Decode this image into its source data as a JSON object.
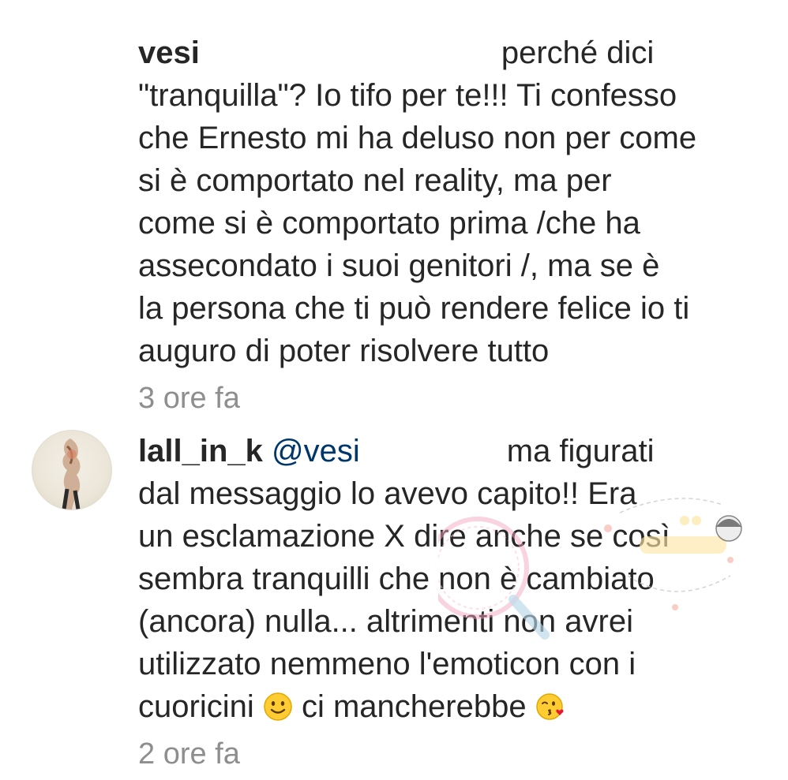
{
  "comments": [
    {
      "username": "vesi",
      "mention": "",
      "lines": [
        "perché dici",
        "\"tranquilla\"? Io tifo per te!!! Ti confesso",
        "che Ernesto mi ha deluso non per come",
        "si è comportato nel reality, ma per",
        "come si è comportato prima /che ha",
        "assecondato i suoi genitori /, ma se è",
        "la persona che ti può rendere felice io ti",
        "auguro di poter risolvere tutto"
      ],
      "time": "3 ore fa"
    },
    {
      "username": "lall_in_k",
      "mention": "@vesi",
      "lines": [
        "ma figurati",
        "dal messaggio lo avevo capito!! Era",
        "un esclamazione X dire anche se così",
        "sembra tranquilli che non è cambiato",
        "(ancora) nulla... altrimenti non avrei",
        "utilizzato nemmeno l'emoticon con i",
        "cuoricini",
        "ci mancherebbe"
      ],
      "time": "2 ore fa"
    }
  ],
  "icons": {
    "smile_emoji": "slightly-smiling-face-icon",
    "kiss_emoji": "face-blowing-kiss-icon"
  },
  "colors": {
    "text": "#262626",
    "secondary": "#8e8e8e",
    "mention": "#00376b"
  }
}
